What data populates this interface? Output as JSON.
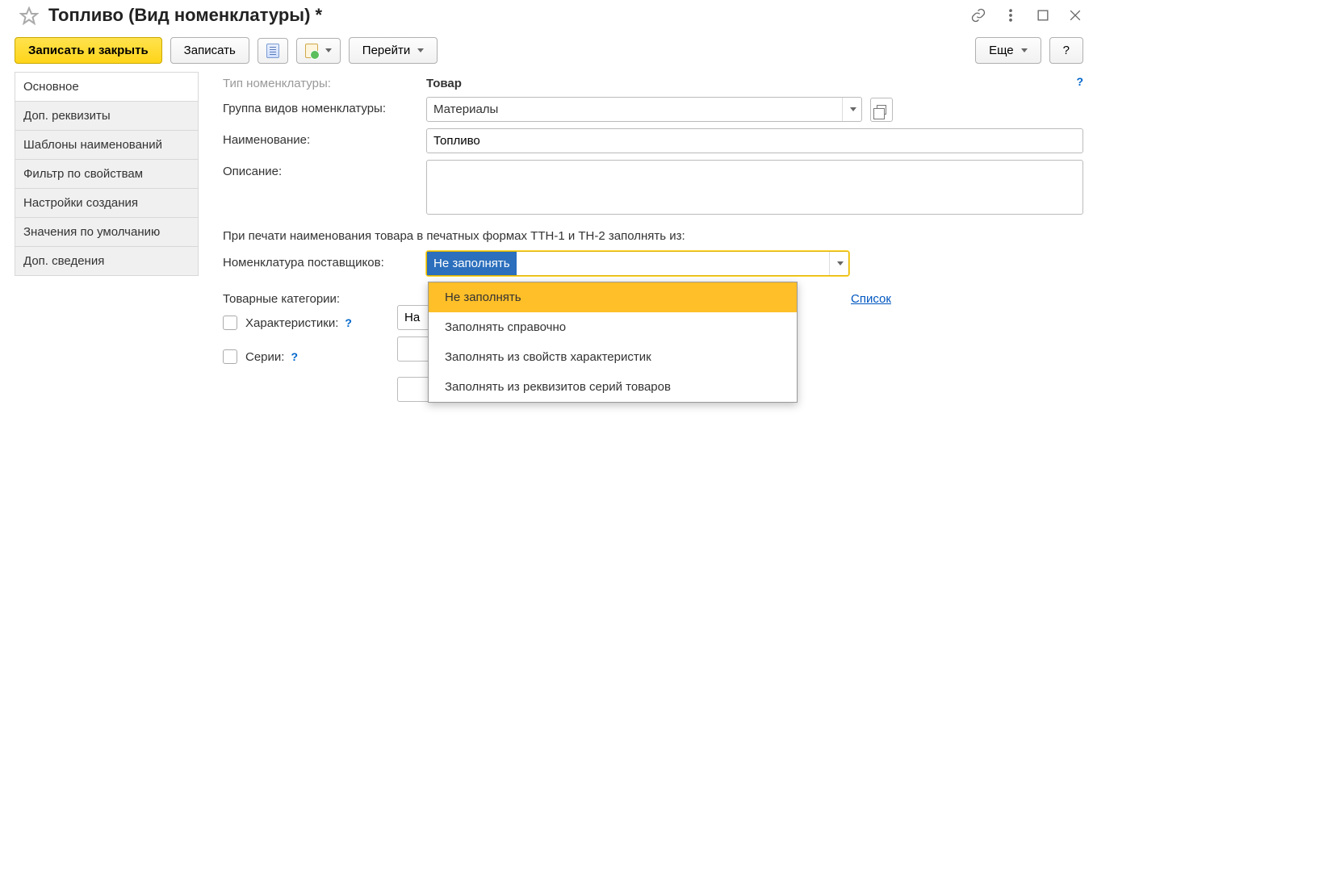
{
  "title": "Топливо (Вид номенклатуры) *",
  "toolbar": {
    "save_close": "Записать и закрыть",
    "save": "Записать",
    "goto": "Перейти",
    "more": "Еще",
    "help": "?"
  },
  "nav": {
    "items": [
      "Основное",
      "Доп. реквизиты",
      "Шаблоны наименований",
      "Фильтр по свойствам",
      "Настройки создания",
      "Значения по умолчанию",
      "Доп. сведения"
    ]
  },
  "form": {
    "type_label": "Тип номенклатуры:",
    "type_value": "Товар",
    "group_label": "Группа видов номенклатуры:",
    "group_value": "Материалы",
    "name_label": "Наименование:",
    "name_value": "Топливо",
    "desc_label": "Описание:",
    "desc_value": "",
    "print_hint": "При печати наименования товара в печатных формах ТТН-1 и ТН-2 заполнять из:",
    "supplier_label": "Номенклатура поставщиков:",
    "supplier_value": "Не заполнять",
    "categories_label": "Товарные категории:",
    "categories_prefix": "На",
    "list_link": "Список",
    "characteristics_label": "Характеристики:",
    "series_label": "Серии:",
    "help_q": "?"
  },
  "dropdown": {
    "options": [
      "Не заполнять",
      "Заполнять справочно",
      "Заполнять из свойств характеристик",
      "Заполнять из реквизитов серий товаров"
    ]
  }
}
